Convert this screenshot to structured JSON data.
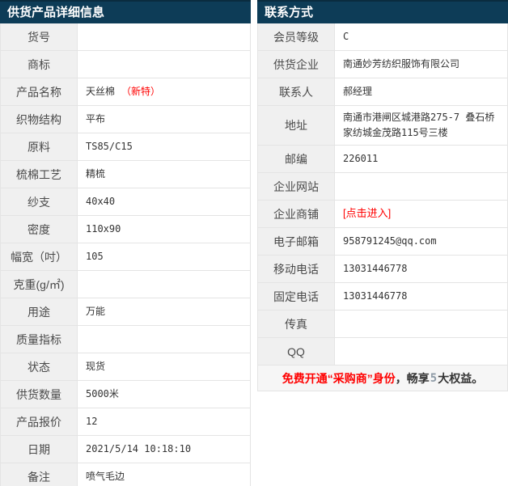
{
  "left_table": {
    "title": "供货产品详细信息",
    "rows": [
      {
        "label": "货号",
        "value": ""
      },
      {
        "label": "商标",
        "value": ""
      },
      {
        "label": "产品名称",
        "value": "天丝棉",
        "extra": "（新特）"
      },
      {
        "label": "织物结构",
        "value": "平布"
      },
      {
        "label": "原料",
        "value": "TS85/C15"
      },
      {
        "label": "梳棉工艺",
        "value": "精梳"
      },
      {
        "label": "纱支",
        "value": "40x40"
      },
      {
        "label": "密度",
        "value": "110x90"
      },
      {
        "label": "幅宽（吋）",
        "value": "105"
      },
      {
        "label": "克重(g/㎡)",
        "value": ""
      },
      {
        "label": "用途",
        "value": "万能"
      },
      {
        "label": "质量指标",
        "value": ""
      },
      {
        "label": "状态",
        "value": "现货"
      },
      {
        "label": "供货数量",
        "value": "5000米"
      },
      {
        "label": "产品报价",
        "value": "12"
      },
      {
        "label": "日期",
        "value": "2021/5/14 10:18:10"
      },
      {
        "label": "备注",
        "value": "喷气毛边"
      }
    ]
  },
  "right_table": {
    "title": "联系方式",
    "rows": [
      {
        "label": "会员等级",
        "value": "C"
      },
      {
        "label": "供货企业",
        "value": "南通妙芳纺织服饰有限公司"
      },
      {
        "label": "联系人",
        "value": "郝经理"
      },
      {
        "label": "地址",
        "value": "南通市港闸区城港路275-7 叠石桥家纺城金茂路115号三楼"
      },
      {
        "label": "邮编",
        "value": "226011"
      },
      {
        "label": "企业网站",
        "value": ""
      },
      {
        "label": "企业商铺",
        "value": "[点击进入]",
        "type": "link"
      },
      {
        "label": "电子邮箱",
        "value": "958791245@qq.com"
      },
      {
        "label": "移动电话",
        "value": "13031446778"
      },
      {
        "label": "固定电话",
        "value": "13031446778"
      },
      {
        "label": "传真",
        "value": ""
      },
      {
        "label": "QQ",
        "value": ""
      }
    ],
    "footer": {
      "red_text": "免费开通“采购商”身份",
      "mid_text": "，畅享",
      "count": "5",
      "tail_text": "大权益。"
    }
  },
  "colors": {
    "header_bg": "#0d3c57",
    "header_top_border": "#0a2c3f",
    "label_cell_bg": "#f0f0f0",
    "row_border": "#e4e4e4",
    "accent_red": "#ff0000",
    "promo_count": "#8d9aa6",
    "header_text": "#ffffff",
    "body_text": "#333333"
  }
}
